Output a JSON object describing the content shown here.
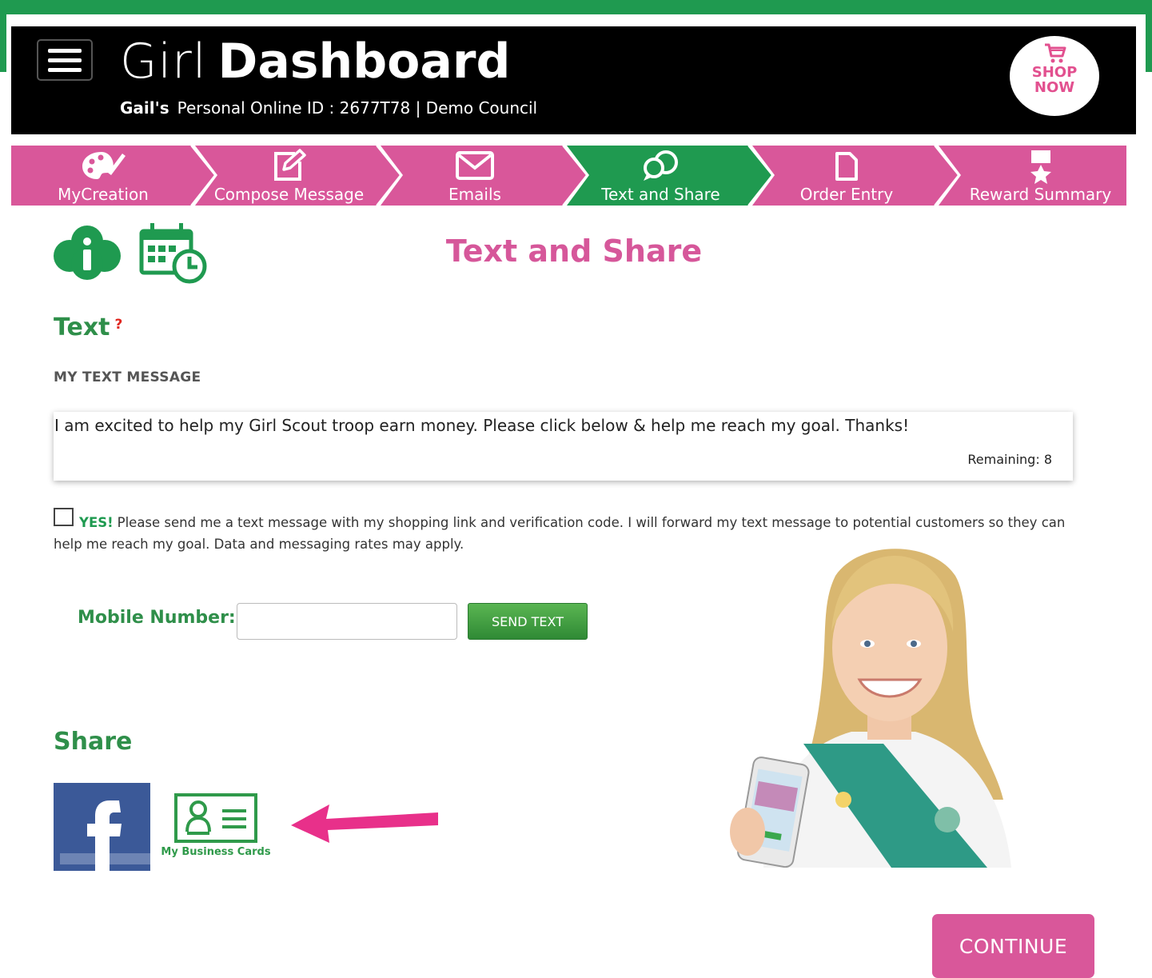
{
  "header": {
    "brand_thin": "Girl",
    "brand_bold": "Dashboard",
    "owner": "Gail's",
    "id_line": "Personal Online ID : 2677T78 | Demo Council",
    "shop_line1": "SHOP",
    "shop_line2": "NOW"
  },
  "tabs": [
    {
      "label": "MyCreation",
      "icon": "palette-icon",
      "active": false
    },
    {
      "label": "Compose Message",
      "icon": "edit-icon",
      "active": false
    },
    {
      "label": "Emails",
      "icon": "envelope-icon",
      "active": false
    },
    {
      "label": "Text and Share",
      "icon": "chat-bubbles-icon",
      "active": true
    },
    {
      "label": "Order Entry",
      "icon": "document-icon",
      "active": false
    },
    {
      "label": "Reward Summary",
      "icon": "award-icon",
      "active": false
    }
  ],
  "page": {
    "title": "Text and Share"
  },
  "text_section": {
    "heading": "Text",
    "help": "?",
    "message_label": "MY TEXT MESSAGE",
    "message": "I am excited to help my Girl Scout troop earn money. Please click below & help me reach my goal. Thanks!",
    "remaining": "Remaining: 8",
    "consent_yes": "YES!",
    "consent_text": "Please send me a text message with my shopping link and verification code. I will forward my text message to potential customers so they can help me reach my goal. Data and messaging rates may apply.",
    "mobile_label": "Mobile Number:",
    "mobile_value": "",
    "send_label": "SEND TEXT"
  },
  "share_section": {
    "heading": "Share",
    "business_cards_label": "My Business Cards"
  },
  "continue_label": "CONTINUE",
  "colors": {
    "pink": "#d9579a",
    "green": "#1f9a50",
    "header_bg": "#000000"
  }
}
